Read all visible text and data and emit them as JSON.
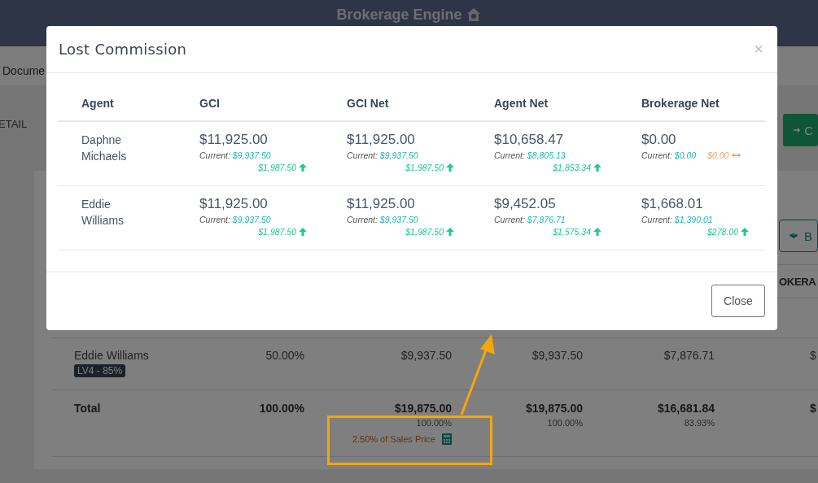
{
  "header": {
    "logo": "Brokerage Engine"
  },
  "subnav": {
    "tab": "Docume"
  },
  "page": {
    "section_label": "ETAIL",
    "action_button": "C",
    "secondary_button": "B",
    "table": {
      "column_header": "OKERA",
      "rows": [
        {
          "name": "Eddie Williams",
          "badge": "LV4 - 85%",
          "cells": [
            "50.00%",
            "$9,937.50",
            "$9,937.50",
            "$7,876.71",
            "$"
          ]
        }
      ],
      "total": {
        "label": "Total",
        "cells": [
          {
            "value": "100.00%"
          },
          {
            "value": "$19,875.00",
            "sub": "100.00%",
            "note": "2.50% of Sales Price"
          },
          {
            "value": "$19,875.00",
            "sub": "100.00%"
          },
          {
            "value": "$16,681.84",
            "sub": "83.93%"
          },
          {
            "value": "$"
          }
        ]
      }
    }
  },
  "modal": {
    "title": "Lost Commission",
    "close_icon": "×",
    "agent_header": "Agent",
    "columns": [
      "GCI",
      "GCI Net",
      "Agent Net",
      "Brokerage Net"
    ],
    "rows": [
      {
        "agent": "Daphne Michaels",
        "cells": [
          {
            "amount": "$11,925.00",
            "current_label": "Current:",
            "current": "$9,937.50",
            "delta": "$1,987.50",
            "kind": "increase"
          },
          {
            "amount": "$11,925.00",
            "current_label": "Current:",
            "current": "$9,937.50",
            "delta": "$1,987.50",
            "kind": "increase"
          },
          {
            "amount": "$10,658.47",
            "current_label": "Current:",
            "current": "$8,805.13",
            "delta": "$1,853.34",
            "kind": "increase"
          },
          {
            "amount": "$0.00",
            "current_label": "Current:",
            "current": "$0.00",
            "delta": "$0.00",
            "kind": "unchanged"
          }
        ]
      },
      {
        "agent": "Eddie Williams",
        "cells": [
          {
            "amount": "$11,925.00",
            "current_label": "Current:",
            "current": "$9,937.50",
            "delta": "$1,987.50",
            "kind": "increase"
          },
          {
            "amount": "$11,925.00",
            "current_label": "Current:",
            "current": "$9,937.50",
            "delta": "$1,987.50",
            "kind": "increase"
          },
          {
            "amount": "$9,452.05",
            "current_label": "Current:",
            "current": "$7,876.71",
            "delta": "$1,575.34",
            "kind": "increase"
          },
          {
            "amount": "$1,668.01",
            "current_label": "Current:",
            "current": "$1,390.01",
            "delta": "$278.00",
            "kind": "increase"
          }
        ]
      }
    ],
    "close_button": "Close"
  }
}
